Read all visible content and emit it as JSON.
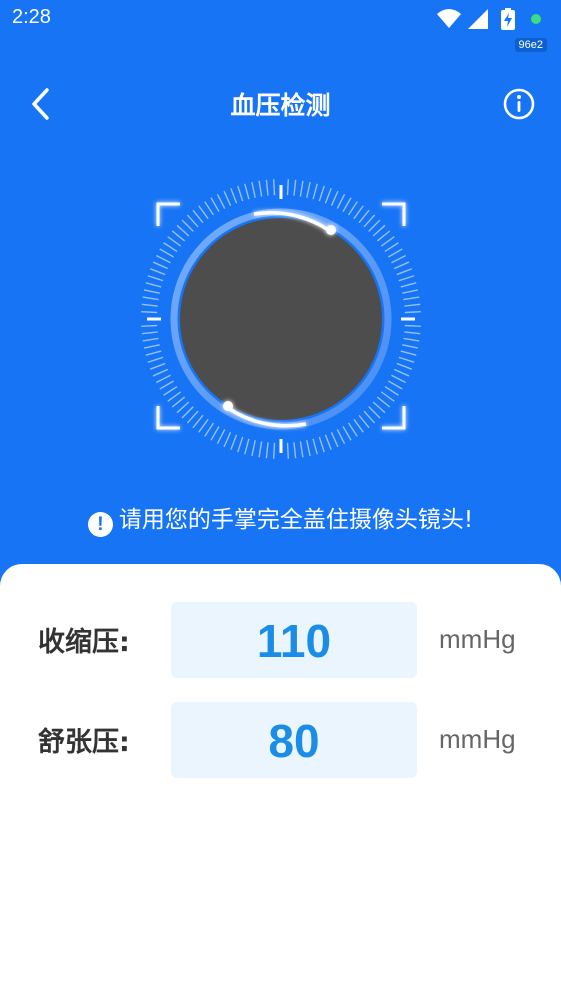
{
  "status_bar": {
    "time": "2:28",
    "badge": "96e2",
    "icons": [
      "wifi-icon",
      "signal-icon",
      "battery-charging-icon",
      "notification-dot-icon"
    ]
  },
  "header": {
    "title": "血压检测",
    "back_icon": "back-arrow-icon",
    "info_icon": "info-icon"
  },
  "camera": {
    "icon_frame": "scan-frame-icon"
  },
  "hint": {
    "text": "请用您的手掌完全盖住摄像头镜头!",
    "icon": "!"
  },
  "results": {
    "systolic": {
      "label": "收缩压:",
      "value": "110",
      "unit": "mmHg"
    },
    "diastolic": {
      "label": "舒张压:",
      "value": "80",
      "unit": "mmHg"
    }
  },
  "colors": {
    "primary": "#1774f4",
    "value_text": "#1b8de6",
    "value_bg": "#eaf5fe",
    "preview": "#4d4d4d"
  }
}
